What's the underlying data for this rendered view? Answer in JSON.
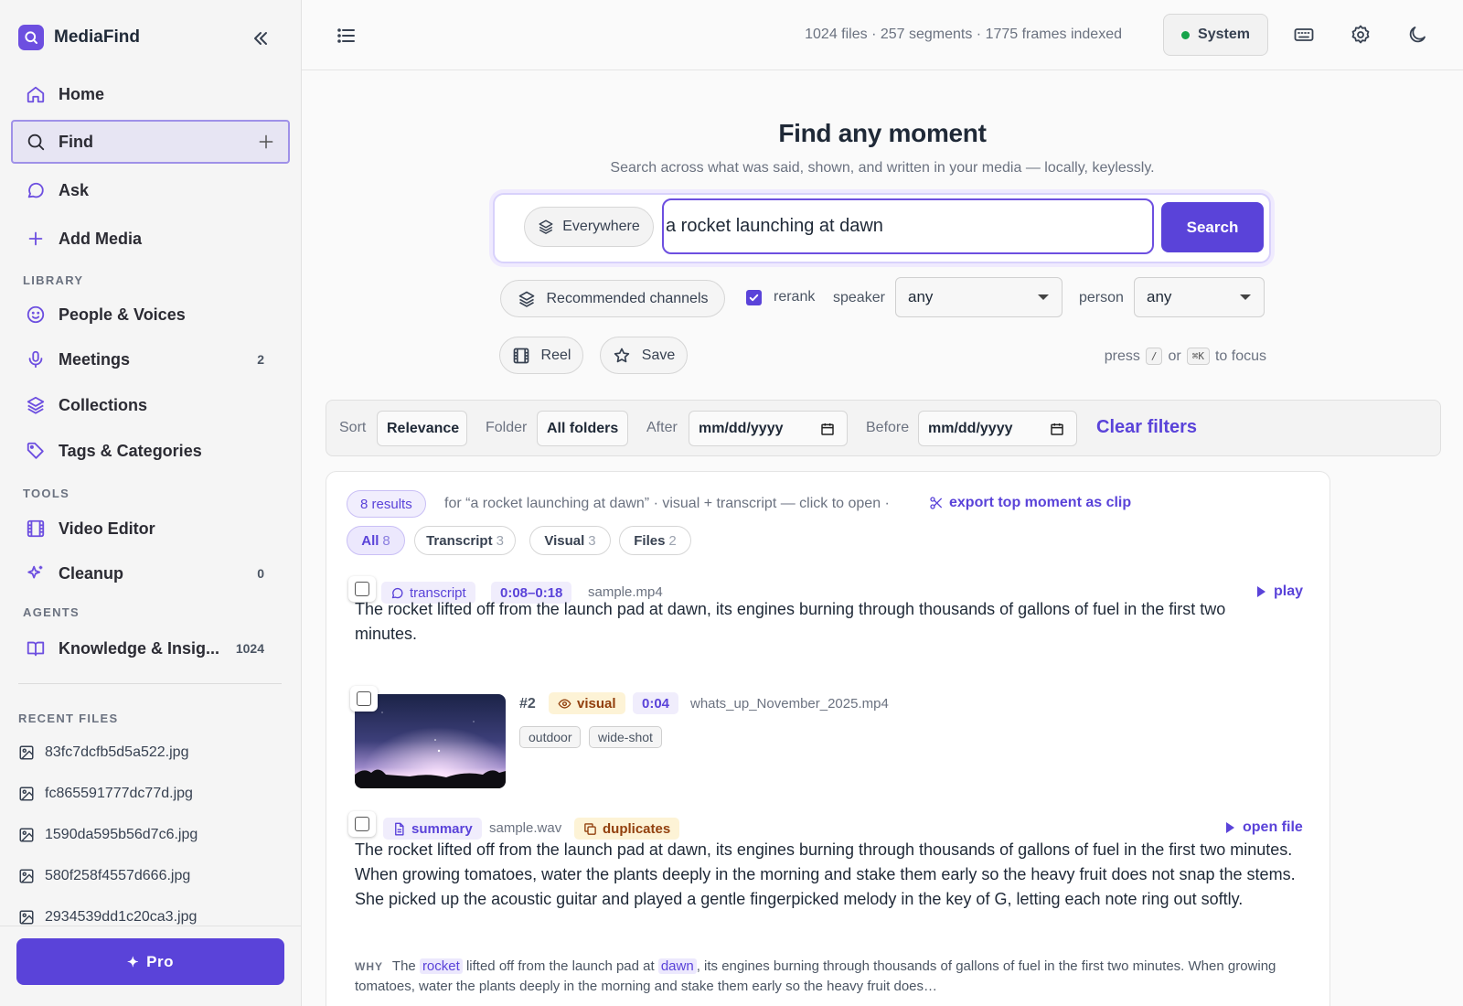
{
  "app": {
    "name": "MediaFind"
  },
  "sidebar": {
    "nav": [
      {
        "label": "Home",
        "icon": "home-icon"
      },
      {
        "label": "Find",
        "icon": "search-icon",
        "active": true
      },
      {
        "label": "Ask",
        "icon": "chat-bubble-icon"
      },
      {
        "label": "Add Media",
        "icon": "plus-icon"
      }
    ],
    "library_label": "LIBRARY",
    "library": [
      {
        "label": "People & Voices",
        "icon": "smile-icon",
        "count": ""
      },
      {
        "label": "Meetings",
        "icon": "microphone-icon",
        "count": "2"
      },
      {
        "label": "Collections",
        "icon": "layers-icon",
        "count": ""
      },
      {
        "label": "Tags & Categories",
        "icon": "tag-icon",
        "count": ""
      }
    ],
    "tools_label": "TOOLS",
    "tools": [
      {
        "label": "Video Editor",
        "icon": "film-icon",
        "count": ""
      },
      {
        "label": "Cleanup",
        "icon": "sparkles-icon",
        "count": "0"
      }
    ],
    "agents_label": "AGENTS",
    "agents": [
      {
        "label": "Knowledge & Insig...",
        "icon": "book-icon",
        "count": "1024"
      }
    ],
    "recent_label": "RECENT FILES",
    "recent_files": [
      "83fc7dcfb5d5a522.jpg",
      "fc865591777dc77d.jpg",
      "1590da595b56d7c6.jpg",
      "580f258f4557d666.jpg",
      "2934539dd1c20ca3.jpg"
    ],
    "pro_label": "Pro"
  },
  "topbar": {
    "stats": "1024 files · 257 segments · 1775 frames indexed",
    "system_label": "System",
    "system_status_color": "#16a34a"
  },
  "hero": {
    "title": "Find any moment",
    "subtitle": "Search across what was said, shown, and written in your media — locally, keylessly."
  },
  "search": {
    "scope_label": "Everywhere",
    "query": "a rocket launching at dawn",
    "button_label": "Search"
  },
  "options": {
    "channels_label": "Recommended channels",
    "rerank_label": "rerank",
    "rerank_checked": true,
    "speaker_label": "speaker",
    "speaker_value": "any",
    "person_label": "person",
    "person_value": "any",
    "reel_label": "Reel",
    "save_label": "Save",
    "hint_press": "press",
    "hint_key1": "/",
    "hint_or": "or",
    "hint_key2": "⌘K",
    "hint_focus": "to focus"
  },
  "filters": {
    "sort_label": "Sort",
    "sort_value": "Relevance",
    "folder_label": "Folder",
    "folder_value": "All folders",
    "after_label": "After",
    "after_value": "mm/dd/yyyy",
    "before_label": "Before",
    "before_value": "mm/dd/yyyy",
    "clear_label": "Clear filters"
  },
  "results": {
    "count_label": "8 results",
    "description": "for “a rocket launching at dawn” · visual + transcript — click to open ·",
    "export_label": "export top moment as clip",
    "tabs": [
      {
        "label": "All",
        "count": "8",
        "active": true
      },
      {
        "label": "Transcript",
        "count": "3"
      },
      {
        "label": "Visual",
        "count": "3"
      },
      {
        "label": "Files",
        "count": "2"
      }
    ],
    "items": [
      {
        "type_label": "transcript",
        "time": "0:08–0:18",
        "file": "sample.mp4",
        "action": "play",
        "text": "The rocket lifted off from the launch pad at dawn, its engines burning through thousands of gallons of fuel in the first two minutes."
      },
      {
        "rank": "#2",
        "type_label": "visual",
        "time": "0:04",
        "file": "whats_up_November_2025.mp4",
        "tags": [
          "outdoor",
          "wide-shot"
        ]
      },
      {
        "type_label": "summary",
        "file": "sample.wav",
        "dup_label": "duplicates",
        "action": "open file",
        "text": "The rocket lifted off from the launch pad at dawn, its engines burning through thousands of gallons of fuel in the first two minutes. When growing tomatoes, water the plants deeply in the morning and stake them early so the heavy fruit does not snap the stems. She picked up the acoustic guitar and played a gentle fingerpicked melody in the key of G, letting each note ring out softly.",
        "why_label": "WHY",
        "why_1": "The",
        "why_hl1": "rocket",
        "why_2": "lifted off from the launch pad at",
        "why_hl2": "dawn",
        "why_3": ", its engines burning through thousands of gallons of fuel in the first two minutes. When growing tomatoes, water the plants deeply in the morning and stake them early so the heavy fruit does…"
      }
    ]
  },
  "colors": {
    "accent": "#5a43d9",
    "accent_light": "#ece8fd",
    "warning_bg": "#fdf3d6"
  }
}
